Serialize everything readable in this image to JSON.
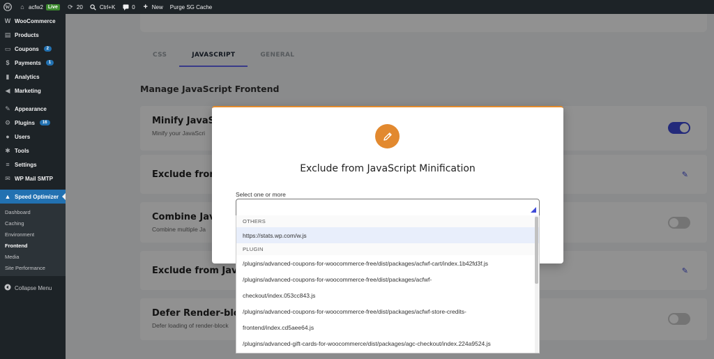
{
  "adminbar": {
    "site_name": "acfw2",
    "live_label": "Live",
    "updates_count": "20",
    "search_shortcut": "Ctrl+K",
    "comments_count": "0",
    "new_label": "New",
    "purge_label": "Purge SG Cache"
  },
  "sidebar": {
    "items": [
      {
        "label": "WooCommerce",
        "icon": "woo-icon"
      },
      {
        "label": "Products",
        "icon": "products-icon"
      },
      {
        "label": "Coupons",
        "icon": "coupons-icon",
        "badge": "2"
      },
      {
        "label": "Payments",
        "icon": "payments-icon",
        "badge": "1"
      },
      {
        "label": "Analytics",
        "icon": "analytics-icon"
      },
      {
        "label": "Marketing",
        "icon": "marketing-icon"
      },
      {
        "label": "Appearance",
        "icon": "appearance-icon"
      },
      {
        "label": "Plugins",
        "icon": "plugins-icon",
        "badge": "16"
      },
      {
        "label": "Users",
        "icon": "users-icon"
      },
      {
        "label": "Tools",
        "icon": "tools-icon"
      },
      {
        "label": "Settings",
        "icon": "settings-icon"
      },
      {
        "label": "WP Mail SMTP",
        "icon": "mail-icon"
      },
      {
        "label": "Speed Optimizer",
        "icon": "speed-icon"
      }
    ],
    "submenu": [
      "Dashboard",
      "Caching",
      "Environment",
      "Frontend",
      "Media",
      "Site Performance"
    ],
    "collapse_label": "Collapse Menu"
  },
  "tabs": [
    "CSS",
    "JAVASCRIPT",
    "GENERAL"
  ],
  "section_title": "Manage JavaScript Frontend",
  "rows": [
    {
      "title": "Minify JavaScri",
      "desc": "Minify your JavaScri"
    },
    {
      "title": "Exclude from",
      "desc": ""
    },
    {
      "title": "Combine Jav",
      "desc": "Combine multiple Ja"
    },
    {
      "title": "Exclude from Java",
      "desc": ""
    },
    {
      "title": "Defer Render-block",
      "desc": "Defer loading of render-block"
    }
  ],
  "modal": {
    "title": "Exclude from JavaScript Minification",
    "select_label": "Select one or more"
  },
  "dropdown": {
    "group_others": "OTHERS",
    "others_options": [
      "https://stats.wp.com/w.js"
    ],
    "group_plugin": "PLUGIN",
    "plugin_options": [
      "/plugins/advanced-coupons-for-woocommerce-free/dist/packages/acfwf-cart/index.1b42fd3f.js",
      "/plugins/advanced-coupons-for-woocommerce-free/dist/packages/acfwf-",
      "checkout/index.053cc843.js",
      "/plugins/advanced-coupons-for-woocommerce-free/dist/packages/acfwf-store-credits-",
      "frontend/index.cd5aee64.js",
      "/plugins/advanced-gift-cards-for-woocommerce/dist/packages/agc-checkout/index.224a9524.js"
    ]
  },
  "colors": {
    "accent": "#3f4ad8",
    "modal_accent": "#e2892f",
    "admin_bg": "#1d2327",
    "active_menu": "#2271b1"
  }
}
